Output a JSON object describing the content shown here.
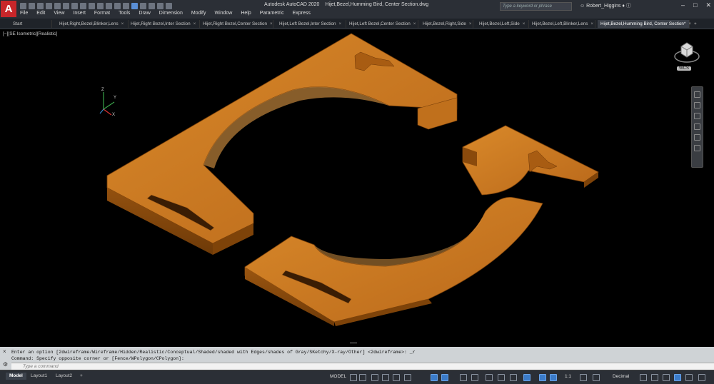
{
  "app": {
    "title": "Autodesk AutoCAD 2020",
    "filename": "Hijet,Bezel,Humming Bird, Center Section.dwg",
    "logo": "A",
    "search_placeholder": "Type a keyword or phrase",
    "user": "Robert_Higgins"
  },
  "menu": [
    "File",
    "Edit",
    "View",
    "Insert",
    "Format",
    "Tools",
    "Draw",
    "Dimension",
    "Modify",
    "Window",
    "Help",
    "Parametric",
    "Express"
  ],
  "tabs": [
    {
      "label": "Start"
    },
    {
      "label": "Hijet,Right,Bezel,Blinker,Lens"
    },
    {
      "label": "Hijet,Right Bezel,Inter Section"
    },
    {
      "label": "Hijet,Right Bezel,Center Section"
    },
    {
      "label": "Hijet,Left Bezel,Inter Section"
    },
    {
      "label": "Hijet,Left Bezel,Center Section"
    },
    {
      "label": "Hijet,Bezel,Right,Side"
    },
    {
      "label": "Hijet,Bezel,Left,Side"
    },
    {
      "label": "Hijet,Bezel,Left,Blinker,Lens"
    },
    {
      "label": "Hijet,Bezel,Humming Bird, Center Section*"
    }
  ],
  "viewport": {
    "label": "[−][SE Isometric][Realistic]",
    "wcs": "WCS",
    "model_color": "#c8731a"
  },
  "command": {
    "line1": "Enter an option [2dwireframe/Wireframe/Hidden/Realistic/Conceptual/Shaded/shaded with Edges/shades of Gray/SKetchy/X-ray/Other] <2dwireframe>: _r",
    "line2": "Command: Specify opposite corner or [Fence/WPolygon/CPolygon]:",
    "placeholder": "Type a command"
  },
  "layout_tabs": [
    "Model",
    "Layout1",
    "Layout2"
  ],
  "status": {
    "model": "MODEL",
    "scale": "1:1",
    "units": "Decimal"
  }
}
